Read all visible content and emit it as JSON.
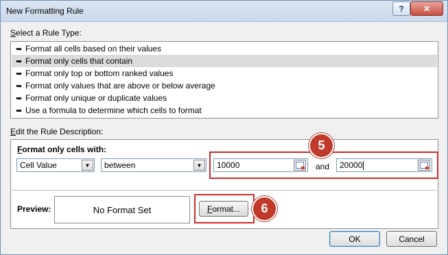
{
  "dialog": {
    "title": "New Formatting Rule",
    "help_label": "?",
    "close_label": "✕"
  },
  "rule_type": {
    "label_key": "S",
    "label_rest": "elect a Rule Type:",
    "items": [
      {
        "label": "Format all cells based on their values"
      },
      {
        "label": "Format only cells that contain"
      },
      {
        "label": "Format only top or bottom ranked values"
      },
      {
        "label": "Format only values that are above or below average"
      },
      {
        "label": "Format only unique or duplicate values"
      },
      {
        "label": "Use a formula to determine which cells to format"
      }
    ],
    "arrow": "➥",
    "selected_index": 1
  },
  "description": {
    "label_key": "E",
    "label_rest": "dit the Rule Description:",
    "format_label_key": "F",
    "format_label_rest": "ormat only cells with:",
    "field_combo": "Cell Value",
    "operator_combo": "between",
    "value1": "10000",
    "and_label": "and",
    "value2": "20000"
  },
  "preview": {
    "label": "Preview:",
    "text": "No Format Set",
    "format_button_key": "F",
    "format_button_rest": "ormat..."
  },
  "buttons": {
    "ok": "OK",
    "cancel": "Cancel"
  },
  "annotations": {
    "step5": "5",
    "step6": "6"
  },
  "colors": {
    "highlight_red": "#d42828",
    "badge_red": "#c0392b",
    "selection_gray": "#dcdcdc"
  }
}
